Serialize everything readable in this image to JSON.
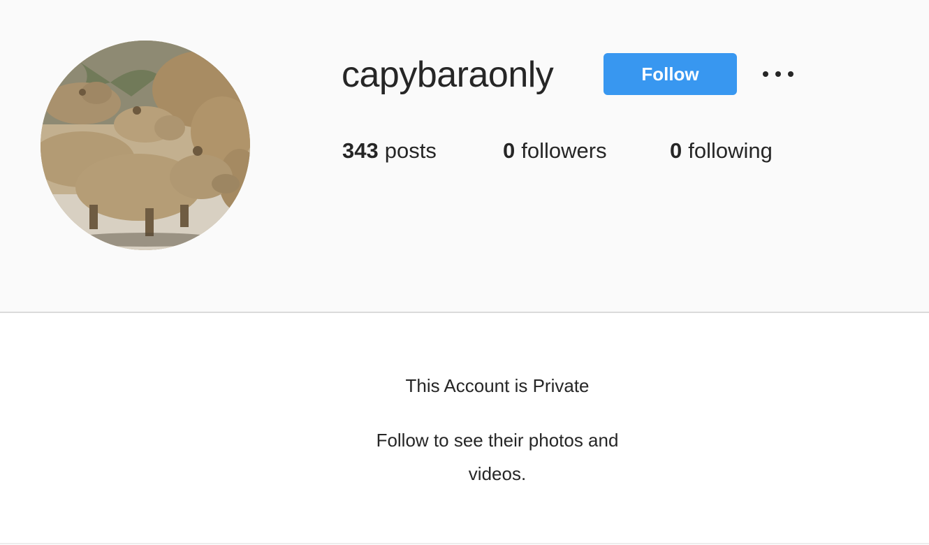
{
  "profile": {
    "username": "capybaraonly",
    "avatar_alt": "capybara herd photo",
    "follow_label": "Follow",
    "more_icon": "more-options-icon"
  },
  "stats": {
    "posts_count": "343",
    "posts_label": "posts",
    "followers_count": "0",
    "followers_label": "followers",
    "following_count": "0",
    "following_label": "following"
  },
  "private_notice": {
    "title": "This Account is Private",
    "message": "Follow to see their photos and videos."
  },
  "colors": {
    "accent": "#3897f0",
    "text": "#262626",
    "header_bg": "#fafafa"
  }
}
